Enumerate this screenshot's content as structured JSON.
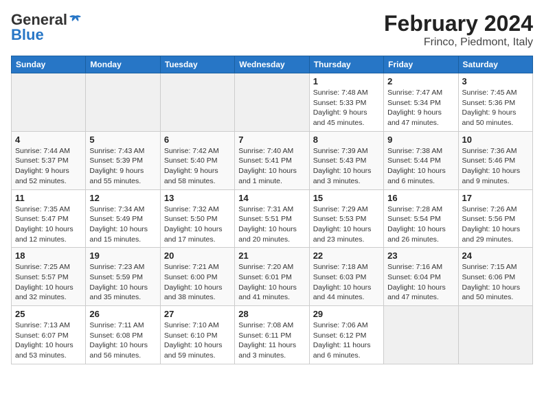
{
  "header": {
    "logo_general": "General",
    "logo_blue": "Blue",
    "title": "February 2024",
    "subtitle": "Frinco, Piedmont, Italy"
  },
  "days_of_week": [
    "Sunday",
    "Monday",
    "Tuesday",
    "Wednesday",
    "Thursday",
    "Friday",
    "Saturday"
  ],
  "weeks": [
    [
      {
        "day": "",
        "info": ""
      },
      {
        "day": "",
        "info": ""
      },
      {
        "day": "",
        "info": ""
      },
      {
        "day": "",
        "info": ""
      },
      {
        "day": "1",
        "info": "Sunrise: 7:48 AM\nSunset: 5:33 PM\nDaylight: 9 hours and 45 minutes."
      },
      {
        "day": "2",
        "info": "Sunrise: 7:47 AM\nSunset: 5:34 PM\nDaylight: 9 hours and 47 minutes."
      },
      {
        "day": "3",
        "info": "Sunrise: 7:45 AM\nSunset: 5:36 PM\nDaylight: 9 hours and 50 minutes."
      }
    ],
    [
      {
        "day": "4",
        "info": "Sunrise: 7:44 AM\nSunset: 5:37 PM\nDaylight: 9 hours and 52 minutes."
      },
      {
        "day": "5",
        "info": "Sunrise: 7:43 AM\nSunset: 5:39 PM\nDaylight: 9 hours and 55 minutes."
      },
      {
        "day": "6",
        "info": "Sunrise: 7:42 AM\nSunset: 5:40 PM\nDaylight: 9 hours and 58 minutes."
      },
      {
        "day": "7",
        "info": "Sunrise: 7:40 AM\nSunset: 5:41 PM\nDaylight: 10 hours and 1 minute."
      },
      {
        "day": "8",
        "info": "Sunrise: 7:39 AM\nSunset: 5:43 PM\nDaylight: 10 hours and 3 minutes."
      },
      {
        "day": "9",
        "info": "Sunrise: 7:38 AM\nSunset: 5:44 PM\nDaylight: 10 hours and 6 minutes."
      },
      {
        "day": "10",
        "info": "Sunrise: 7:36 AM\nSunset: 5:46 PM\nDaylight: 10 hours and 9 minutes."
      }
    ],
    [
      {
        "day": "11",
        "info": "Sunrise: 7:35 AM\nSunset: 5:47 PM\nDaylight: 10 hours and 12 minutes."
      },
      {
        "day": "12",
        "info": "Sunrise: 7:34 AM\nSunset: 5:49 PM\nDaylight: 10 hours and 15 minutes."
      },
      {
        "day": "13",
        "info": "Sunrise: 7:32 AM\nSunset: 5:50 PM\nDaylight: 10 hours and 17 minutes."
      },
      {
        "day": "14",
        "info": "Sunrise: 7:31 AM\nSunset: 5:51 PM\nDaylight: 10 hours and 20 minutes."
      },
      {
        "day": "15",
        "info": "Sunrise: 7:29 AM\nSunset: 5:53 PM\nDaylight: 10 hours and 23 minutes."
      },
      {
        "day": "16",
        "info": "Sunrise: 7:28 AM\nSunset: 5:54 PM\nDaylight: 10 hours and 26 minutes."
      },
      {
        "day": "17",
        "info": "Sunrise: 7:26 AM\nSunset: 5:56 PM\nDaylight: 10 hours and 29 minutes."
      }
    ],
    [
      {
        "day": "18",
        "info": "Sunrise: 7:25 AM\nSunset: 5:57 PM\nDaylight: 10 hours and 32 minutes."
      },
      {
        "day": "19",
        "info": "Sunrise: 7:23 AM\nSunset: 5:59 PM\nDaylight: 10 hours and 35 minutes."
      },
      {
        "day": "20",
        "info": "Sunrise: 7:21 AM\nSunset: 6:00 PM\nDaylight: 10 hours and 38 minutes."
      },
      {
        "day": "21",
        "info": "Sunrise: 7:20 AM\nSunset: 6:01 PM\nDaylight: 10 hours and 41 minutes."
      },
      {
        "day": "22",
        "info": "Sunrise: 7:18 AM\nSunset: 6:03 PM\nDaylight: 10 hours and 44 minutes."
      },
      {
        "day": "23",
        "info": "Sunrise: 7:16 AM\nSunset: 6:04 PM\nDaylight: 10 hours and 47 minutes."
      },
      {
        "day": "24",
        "info": "Sunrise: 7:15 AM\nSunset: 6:06 PM\nDaylight: 10 hours and 50 minutes."
      }
    ],
    [
      {
        "day": "25",
        "info": "Sunrise: 7:13 AM\nSunset: 6:07 PM\nDaylight: 10 hours and 53 minutes."
      },
      {
        "day": "26",
        "info": "Sunrise: 7:11 AM\nSunset: 6:08 PM\nDaylight: 10 hours and 56 minutes."
      },
      {
        "day": "27",
        "info": "Sunrise: 7:10 AM\nSunset: 6:10 PM\nDaylight: 10 hours and 59 minutes."
      },
      {
        "day": "28",
        "info": "Sunrise: 7:08 AM\nSunset: 6:11 PM\nDaylight: 11 hours and 3 minutes."
      },
      {
        "day": "29",
        "info": "Sunrise: 7:06 AM\nSunset: 6:12 PM\nDaylight: 11 hours and 6 minutes."
      },
      {
        "day": "",
        "info": ""
      },
      {
        "day": "",
        "info": ""
      }
    ]
  ]
}
